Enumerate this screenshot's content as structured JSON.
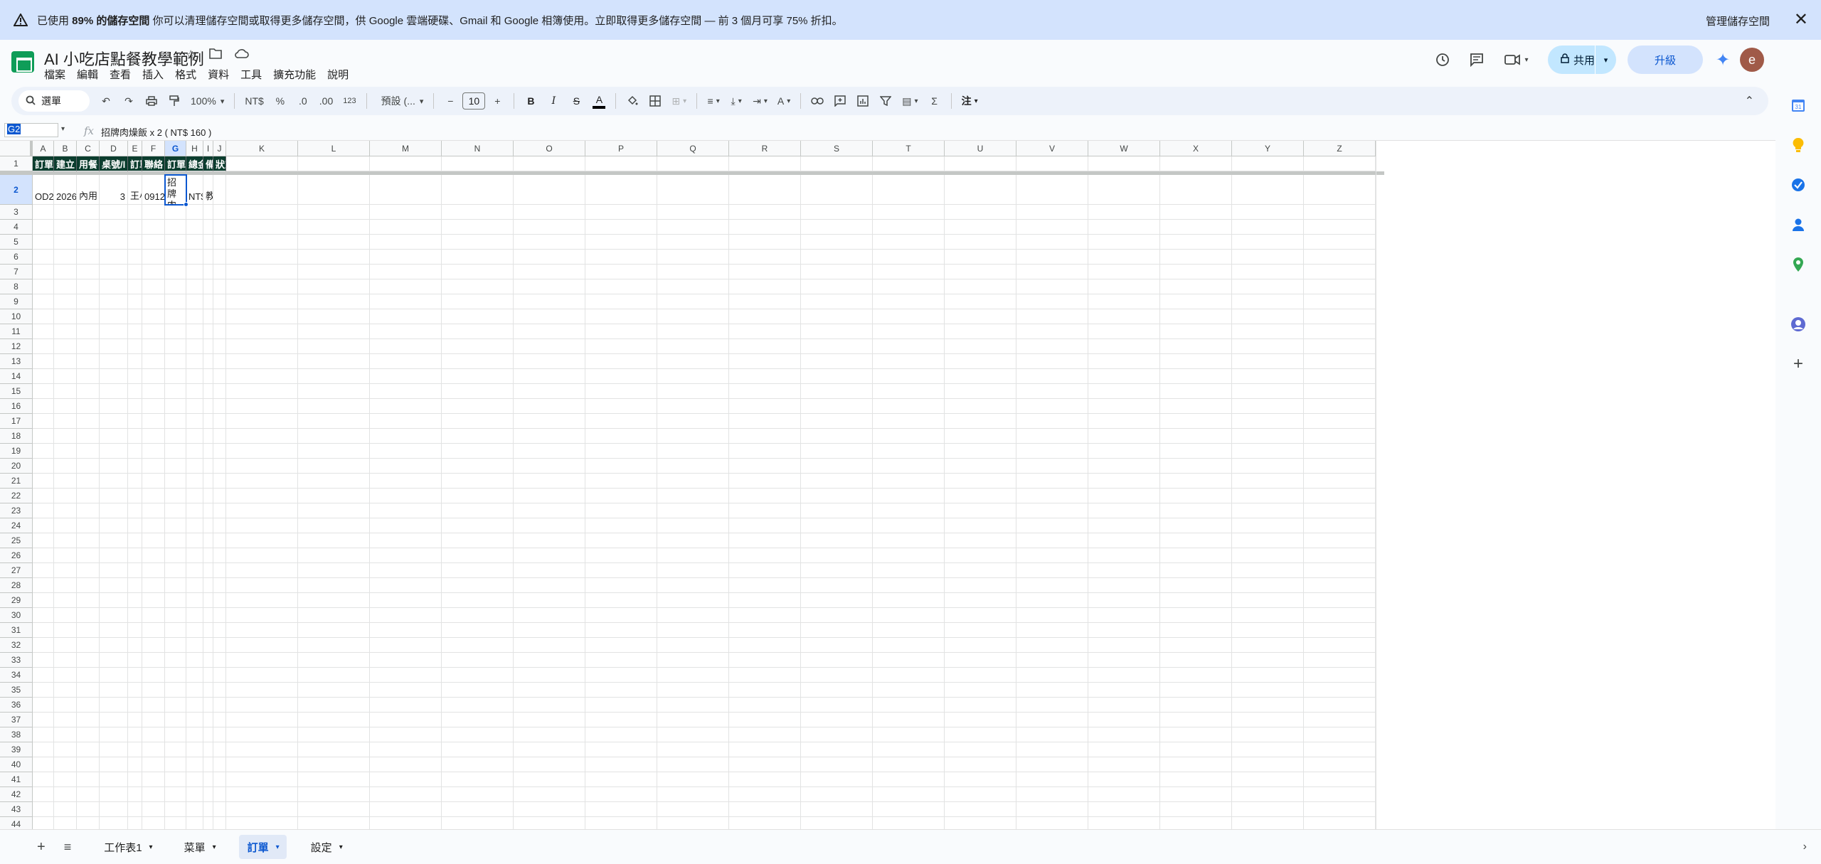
{
  "banner": {
    "prefix": "已使用 ",
    "percent": "89% 的儲存空間",
    "message": " 你可以清理儲存空間或取得更多儲存空間，供 Google 雲端硬碟、Gmail 和 Google 相簿使用。立即取得更多儲存空間 — 前 3 個月可享 75% 折扣。",
    "manage_link": "管理儲存空間",
    "close_icon": "✕"
  },
  "doc": {
    "title": "AI 小吃店點餐教學範例"
  },
  "menu": [
    "檔案",
    "編輯",
    "查看",
    "插入",
    "格式",
    "資料",
    "工具",
    "擴充功能",
    "說明"
  ],
  "header_right": {
    "share_label": "共用",
    "upgrade_label": "升級",
    "avatar_letter": "e"
  },
  "toolbar": {
    "search_label": "選單",
    "zoom": "100%",
    "currency": "NT$",
    "percent": "%",
    "dec_decrease": ".0",
    "dec_increase": ".00",
    "number_format": "123",
    "font": "預設 (...",
    "font_size": "10",
    "bold": "B",
    "italic": "I",
    "strike": "S",
    "text_color": "A"
  },
  "formula_bar": {
    "name_box": "G2",
    "fx": "fx",
    "content": "招牌肉燥飯 x 2 ( NT$ 160 )"
  },
  "grid": {
    "columns": [
      "A",
      "B",
      "C",
      "D",
      "E",
      "F",
      "G",
      "H",
      "I",
      "J",
      "K",
      "L",
      "M",
      "N",
      "O",
      "P",
      "Q",
      "R",
      "S",
      "T",
      "U",
      "V",
      "W",
      "X",
      "Y",
      "Z"
    ],
    "selected_column": "G",
    "row_numbers": [
      "1",
      "2",
      "3",
      "4",
      "5",
      "6",
      "7",
      "8",
      "9",
      "10",
      "11",
      "12",
      "13",
      "14",
      "15",
      "16",
      "17",
      "18",
      "19",
      "20",
      "21",
      "22",
      "23",
      "24",
      "25",
      "26",
      "27",
      "28",
      "29",
      "30",
      "31",
      "32",
      "33",
      "34",
      "35",
      "36",
      "37",
      "38",
      "39",
      "40",
      "41",
      "42",
      "43",
      "44"
    ],
    "header_row": [
      "訂單",
      "建立",
      "用餐",
      "桌號/l",
      "訂單",
      "聯絡",
      "訂單",
      "總金",
      "備",
      "狀態"
    ],
    "row2": [
      "OD2",
      "2026",
      "內用",
      "3",
      "王小",
      "0912",
      "招牌肉燥飯",
      "NT$",
      "教",
      ""
    ],
    "active_cell_text": "招牌\n肉燥"
  },
  "tabs": {
    "add_icon": "+",
    "list_icon": "≡",
    "sheets": [
      "工作表1",
      "菜單",
      "訂單",
      "設定"
    ],
    "active": "訂單"
  },
  "colors": {
    "header_fill": "#0b3d2e",
    "accent": "#0b57d0",
    "banner": "#d3e3fd"
  }
}
